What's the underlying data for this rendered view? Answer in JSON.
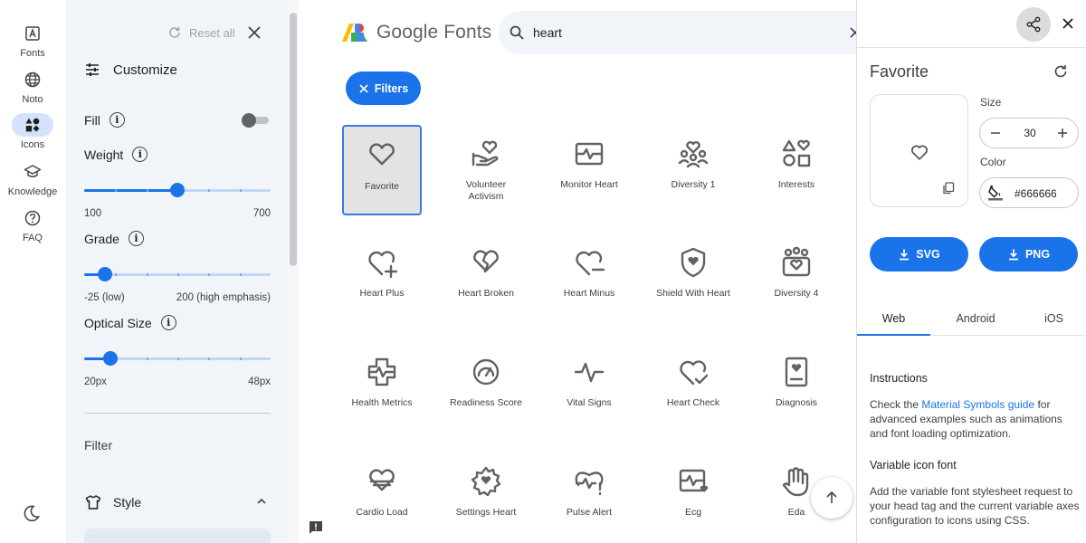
{
  "rail": {
    "items": [
      {
        "label": "Fonts",
        "icon": "fonts-icon"
      },
      {
        "label": "Noto",
        "icon": "globe-icon"
      },
      {
        "label": "Icons",
        "icon": "shapes-icon"
      },
      {
        "label": "Knowledge",
        "icon": "school-icon"
      },
      {
        "label": "FAQ",
        "icon": "help-icon"
      }
    ],
    "active": "Icons"
  },
  "panel": {
    "reset_label": "Reset all",
    "customize_label": "Customize",
    "fill_label": "Fill",
    "fill_on": false,
    "weight": {
      "label": "Weight",
      "min_label": "100",
      "max_label": "700",
      "value": 400,
      "min": 100,
      "max": 700
    },
    "grade": {
      "label": "Grade",
      "min_label": "-25 (low)",
      "max_label": "200 (high emphasis)",
      "value": 0,
      "min": -25,
      "max": 200
    },
    "optical": {
      "label": "Optical Size",
      "min_label": "20px",
      "max_label": "48px",
      "value": 24,
      "min": 20,
      "max": 48
    },
    "filter_label": "Filter",
    "style_label": "Style"
  },
  "main": {
    "logo_text": "Google Fonts",
    "search_value": "heart",
    "filters_label": "Filters",
    "icons": [
      {
        "label": "Favorite",
        "icon": "favorite-icon",
        "selected": true
      },
      {
        "label": "Volunteer Activism",
        "icon": "volunteer-activism-icon"
      },
      {
        "label": "Monitor Heart",
        "icon": "monitor-heart-icon"
      },
      {
        "label": "Diversity 1",
        "icon": "diversity-1-icon"
      },
      {
        "label": "Interests",
        "icon": "interests-icon"
      },
      {
        "label": "Heart Plus",
        "icon": "heart-plus-icon"
      },
      {
        "label": "Heart Broken",
        "icon": "heart-broken-icon"
      },
      {
        "label": "Heart Minus",
        "icon": "heart-minus-icon"
      },
      {
        "label": "Shield With Heart",
        "icon": "shield-with-heart-icon"
      },
      {
        "label": "Diversity 4",
        "icon": "diversity-4-icon"
      },
      {
        "label": "Health Metrics",
        "icon": "health-metrics-icon"
      },
      {
        "label": "Readiness Score",
        "icon": "readiness-score-icon"
      },
      {
        "label": "Vital Signs",
        "icon": "vital-signs-icon"
      },
      {
        "label": "Heart Check",
        "icon": "heart-check-icon"
      },
      {
        "label": "Diagnosis",
        "icon": "diagnosis-icon"
      },
      {
        "label": "Cardio Load",
        "icon": "cardio-load-icon"
      },
      {
        "label": "Settings Heart",
        "icon": "settings-heart-icon"
      },
      {
        "label": "Pulse Alert",
        "icon": "pulse-alert-icon"
      },
      {
        "label": "Ecg",
        "icon": "ecg-icon"
      },
      {
        "label": "Eda",
        "icon": "eda-icon"
      }
    ]
  },
  "detail": {
    "title": "Favorite",
    "size_label": "Size",
    "size_value": "30",
    "color_label": "Color",
    "color_value": "#666666",
    "svg_label": "SVG",
    "png_label": "PNG",
    "tabs": [
      "Web",
      "Android",
      "iOS"
    ],
    "active_tab": "Web",
    "instructions_heading": "Instructions",
    "instructions_pre": "Check the ",
    "instructions_link": "Material Symbols guide",
    "instructions_post": " for advanced examples such as animations and font loading optimization.",
    "variable_heading": "Variable icon font",
    "variable_text": "Add the variable font stylesheet request to your head tag and the current variable axes configuration to icons using CSS."
  },
  "colors": {
    "accent": "#1a73e8",
    "icon": "#5f6368",
    "panel_bg": "#f1f4f9",
    "selected_bg": "#e3e3e3"
  }
}
